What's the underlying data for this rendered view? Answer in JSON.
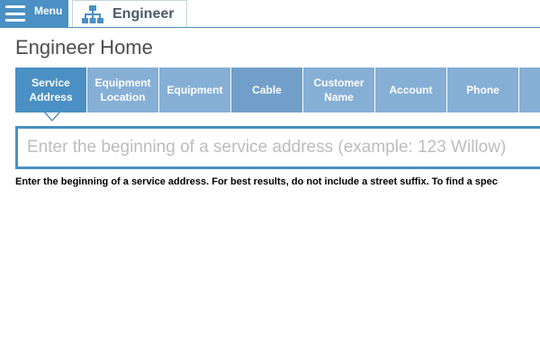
{
  "topbar": {
    "menu_label": "Menu",
    "app_name": "Engineer"
  },
  "page": {
    "title": "Engineer Home"
  },
  "tabs": [
    {
      "label": "Service Address"
    },
    {
      "label": "Equipment Location"
    },
    {
      "label": "Equipment"
    },
    {
      "label": "Cable"
    },
    {
      "label": "Customer Name"
    },
    {
      "label": "Account"
    },
    {
      "label": "Phone"
    }
  ],
  "search": {
    "placeholder": "Enter the beginning of a service address (example: 123 Willow)",
    "value": ""
  },
  "help": {
    "text": "Enter the beginning of a service address. For best results, do not include a street suffix. To find a spec"
  },
  "colors": {
    "accent": "#4a90c4",
    "tab": "#86afd6",
    "tab_dark": "#729fc9"
  },
  "icons": {
    "menu": "hamburger-icon",
    "app": "org-chart-icon"
  }
}
